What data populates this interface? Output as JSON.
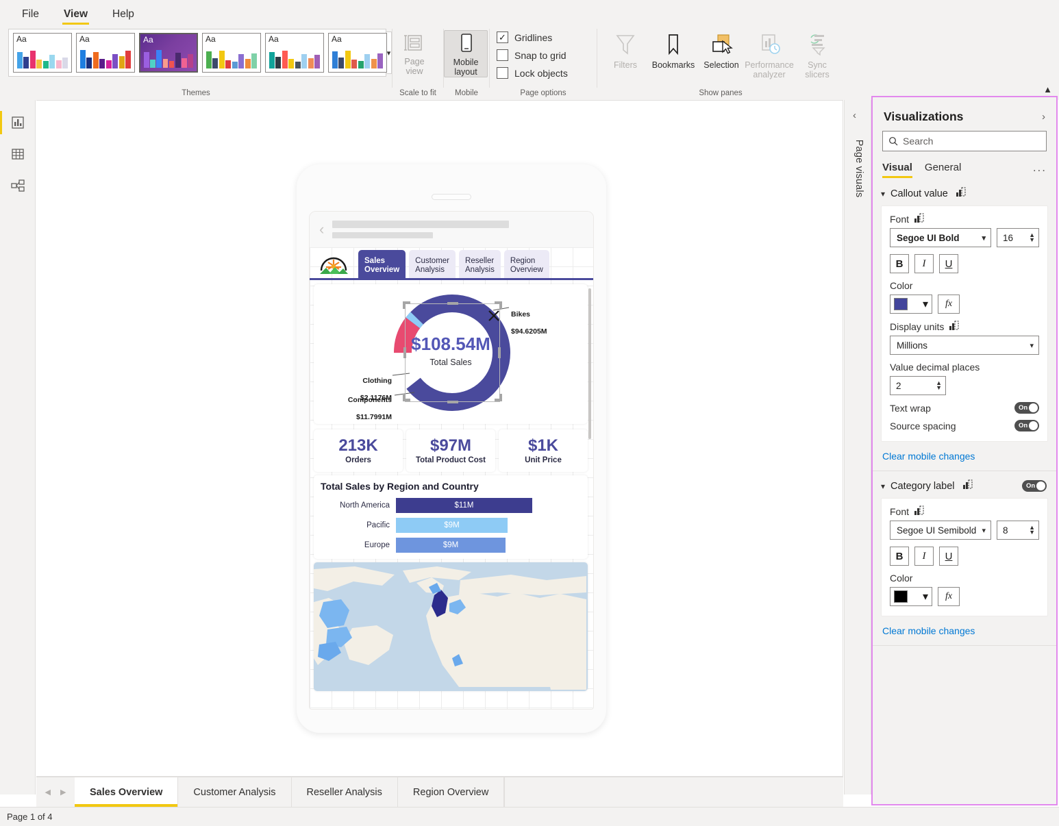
{
  "ribbon": {
    "tabs": [
      {
        "label": "File",
        "active": false
      },
      {
        "label": "View",
        "active": true
      },
      {
        "label": "Help",
        "active": false
      }
    ],
    "groups": {
      "themes": {
        "label": "Themes",
        "more_icon": "chevron-down-icon",
        "swatches": [
          {
            "aa": "Aa",
            "selected": false,
            "colors": [
              "#44a3e8",
              "#2e3f8f",
              "#e8336d",
              "#f5c242",
              "#1fb98a",
              "#9ad8ef",
              "#f7b7cd",
              "#d9d9e8"
            ]
          },
          {
            "aa": "Aa",
            "selected": false,
            "colors": [
              "#1e7ee0",
              "#19307e",
              "#ef6c1f",
              "#5b1b8a",
              "#d6219b",
              "#7b4fc4",
              "#e0a615",
              "#e03c3c"
            ]
          },
          {
            "aa": "Aa",
            "selected": true,
            "colors": [
              "#9b5fe0",
              "#4fd1c5",
              "#3b82f6",
              "#f89b8c",
              "#ef5350",
              "#4a2a6e",
              "#f06292",
              "#b5408a"
            ]
          },
          {
            "aa": "Aa",
            "selected": false,
            "colors": [
              "#4caf50",
              "#3c4a6b",
              "#f2c811",
              "#e03c3c",
              "#5b9bd5",
              "#8a6fd1",
              "#f08c3c",
              "#7fd1a8"
            ]
          },
          {
            "aa": "Aa",
            "selected": false,
            "colors": [
              "#11a39a",
              "#2f3b44",
              "#ff5a52",
              "#f2c811",
              "#4a5560",
              "#9fd0f0",
              "#f08c57",
              "#a05fb5"
            ]
          },
          {
            "aa": "Aa",
            "selected": false,
            "colors": [
              "#2f7fd6",
              "#3c4a6b",
              "#f2c811",
              "#e05a4a",
              "#25a36c",
              "#9fd0f0",
              "#f0924a",
              "#9a63c0"
            ]
          }
        ]
      },
      "scale_to_fit": {
        "label": "Scale to fit",
        "page_view": {
          "label": "Page\nview",
          "icon": "page-view-icon",
          "disabled": true,
          "has_caret": true
        }
      },
      "mobile": {
        "label": "Mobile",
        "mobile_layout": {
          "label": "Mobile\nlayout",
          "icon": "mobile-layout-icon",
          "pressed": true
        }
      },
      "page_options": {
        "label": "Page options",
        "checkboxes": [
          {
            "label": "Gridlines",
            "checked": true
          },
          {
            "label": "Snap to grid",
            "checked": false
          },
          {
            "label": "Lock objects",
            "checked": false
          }
        ]
      },
      "show_panes": {
        "label": "Show panes",
        "buttons": [
          {
            "label": "Filters",
            "icon": "filter-funnel-icon",
            "disabled": true
          },
          {
            "label": "Bookmarks",
            "icon": "bookmark-icon",
            "disabled": false
          },
          {
            "label": "Selection",
            "icon": "selection-icon",
            "disabled": false,
            "cursor": true
          },
          {
            "label": "Performance\nanalyzer",
            "icon": "performance-analyzer-icon",
            "disabled": true
          },
          {
            "label": "Sync\nslicers",
            "icon": "sync-slicers-icon",
            "disabled": true
          }
        ]
      }
    },
    "collapse_icon": "chevron-up-icon"
  },
  "rail": {
    "items": [
      {
        "name": "report-view",
        "icon": "report-bar-chart-icon",
        "active": true
      },
      {
        "name": "data-view",
        "icon": "data-table-icon",
        "active": false
      },
      {
        "name": "model-view",
        "icon": "model-relationship-icon",
        "active": false
      }
    ]
  },
  "phone": {
    "back_icon": "chevron-left-icon",
    "nav": {
      "logo_icon": "sunrise-mountain-logo-icon",
      "tabs": [
        {
          "label": "Sales\nOverview",
          "selected": true
        },
        {
          "label": "Customer\nAnalysis",
          "selected": false
        },
        {
          "label": "Reseller\nAnalysis",
          "selected": false
        },
        {
          "label": "Region\nOverview",
          "selected": false
        }
      ]
    },
    "donut": {
      "callout_value": "$108.54M",
      "callout_label": "Total Sales",
      "labels": [
        {
          "name": "Bikes",
          "value": "$94.6205M"
        },
        {
          "name": "Clothing",
          "value": "$2.1176M"
        },
        {
          "name": "Components",
          "value": "$11.7991M"
        }
      ],
      "remove_icon": "remove-x-icon"
    },
    "kpis": [
      {
        "value": "213K",
        "label": "Orders"
      },
      {
        "value": "$97M",
        "label": "Total Product Cost"
      },
      {
        "value": "$1K",
        "label": "Unit Price"
      }
    ],
    "bars": {
      "title": "Total Sales by Region and Country"
    }
  },
  "chart_data": [
    {
      "type": "pie",
      "title": "Total Sales",
      "center_value": "$108.54M",
      "categories": [
        "Bikes",
        "Components",
        "Clothing"
      ],
      "labels": [
        "$94.6205M",
        "$11.7991M",
        "$2.1176M"
      ],
      "values": [
        94.6205,
        11.7991,
        2.1176
      ],
      "colors": [
        "#4a4a9c",
        "#e84a70",
        "#8ecbf5"
      ],
      "legend": "data-labels",
      "grid": false
    },
    {
      "type": "bar",
      "title": "Total Sales by Region and Country",
      "orientation": "horizontal",
      "categories": [
        "North America",
        "Pacific",
        "Europe"
      ],
      "values": [
        11,
        9,
        9
      ],
      "labels": [
        "$11M",
        "$9M",
        "$9M"
      ],
      "colors": [
        "#3d3d8f",
        "#8ecbf5",
        "#6e95de"
      ],
      "xlabel": "",
      "ylabel": "",
      "grid": false,
      "legend": "none"
    }
  ],
  "page_visuals": {
    "title": "Page visuals",
    "collapse_icon": "chevron-left-icon"
  },
  "format_pane": {
    "title": "Visualizations",
    "expand_icon": "chevron-right-icon",
    "search": {
      "placeholder": "Search",
      "icon": "search-icon",
      "value": ""
    },
    "tabs": [
      {
        "label": "Visual",
        "active": true
      },
      {
        "label": "General",
        "active": false
      }
    ],
    "more_label": "...",
    "sections": [
      {
        "name": "Callout value",
        "chevron_icon": "chevron-down-icon",
        "revert_icon": "revert-to-default-icon",
        "font_label": "Font",
        "font_family": "Segoe UI Bold",
        "font_size": "16",
        "bold": "B",
        "italic": "I",
        "underline": "U",
        "color_label": "Color",
        "color_value": "#43459b",
        "fx_label": "fx",
        "display_units_label": "Display units",
        "display_units_value": "Millions",
        "decimals_label": "Value decimal places",
        "decimals_value": "2",
        "text_wrap_label": "Text wrap",
        "text_wrap_state": "On",
        "source_spacing_label": "Source spacing",
        "source_spacing_state": "On",
        "clear_link": "Clear mobile changes"
      },
      {
        "name": "Category label",
        "chevron_icon": "chevron-down-icon",
        "revert_icon": "revert-to-default-icon",
        "toggle_state": "On",
        "font_label": "Font",
        "font_family": "Segoe UI Semibold",
        "font_size": "8",
        "bold": "B",
        "italic": "I",
        "underline": "U",
        "color_label": "Color",
        "color_value": "#000000",
        "fx_label": "fx",
        "clear_link": "Clear mobile changes"
      }
    ]
  },
  "page_tabs": {
    "prev_icon": "prev-page-icon",
    "next_icon": "next-page-icon",
    "items": [
      {
        "label": "Sales Overview",
        "active": true
      },
      {
        "label": "Customer Analysis",
        "active": false
      },
      {
        "label": "Reseller Analysis",
        "active": false
      },
      {
        "label": "Region Overview",
        "active": false
      }
    ]
  },
  "status_bar": {
    "text": "Page 1 of 4"
  },
  "colors": {
    "accent_yellow": "#f2c811",
    "brand_purple": "#4a4a9c",
    "pane_border_pink": "#e288ed",
    "link_blue": "#0078d4"
  }
}
